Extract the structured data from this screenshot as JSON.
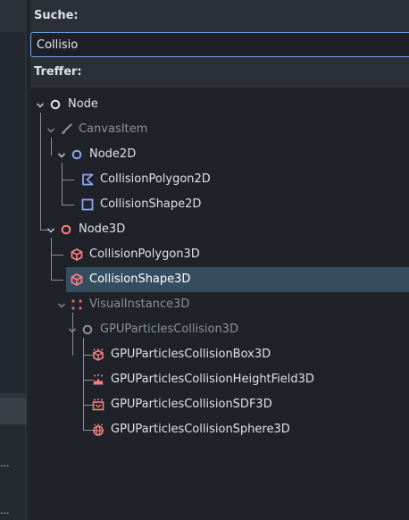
{
  "search": {
    "label": "Suche:",
    "value": "Collisio"
  },
  "results": {
    "label": "Treffer:"
  },
  "left_panel": {
    "truncated_text_1": "...",
    "truncated_text_2": "..."
  },
  "colors": {
    "accent": "#6fa8e5",
    "node2d": "#8da5f3",
    "node3d": "#fc7f7f",
    "selected_row": "#354e5f"
  },
  "tree": {
    "nodes": [
      {
        "label": "Node",
        "icon": "circle-outline-icon",
        "expanded": true,
        "dimmed": false
      },
      {
        "label": "CanvasItem",
        "icon": "brush-icon",
        "expanded": true,
        "dimmed": true
      },
      {
        "label": "Node2D",
        "icon": "circle-outline-icon",
        "expanded": true,
        "dimmed": false
      },
      {
        "label": "CollisionPolygon2D",
        "icon": "polygon-2d-icon",
        "dimmed": false
      },
      {
        "label": "CollisionShape2D",
        "icon": "square-outline-icon",
        "dimmed": false
      },
      {
        "label": "Node3D",
        "icon": "circle-outline-icon",
        "expanded": true,
        "dimmed": false
      },
      {
        "label": "CollisionPolygon3D",
        "icon": "cube-icon",
        "dimmed": false
      },
      {
        "label": "CollisionShape3D",
        "icon": "cube-icon",
        "dimmed": false,
        "selected": true
      },
      {
        "label": "VisualInstance3D",
        "icon": "dots-icon",
        "expanded": true,
        "dimmed": true
      },
      {
        "label": "GPUParticlesCollision3D",
        "icon": "circle-outline-icon",
        "expanded": true,
        "dimmed": true
      },
      {
        "label": "GPUParticlesCollisionBox3D",
        "icon": "particles-box-icon",
        "dimmed": false
      },
      {
        "label": "GPUParticlesCollisionHeightField3D",
        "icon": "particles-heightfield-icon",
        "dimmed": false
      },
      {
        "label": "GPUParticlesCollisionSDF3D",
        "icon": "particles-sdf-icon",
        "dimmed": false
      },
      {
        "label": "GPUParticlesCollisionSphere3D",
        "icon": "particles-sphere-icon",
        "dimmed": false
      }
    ]
  }
}
